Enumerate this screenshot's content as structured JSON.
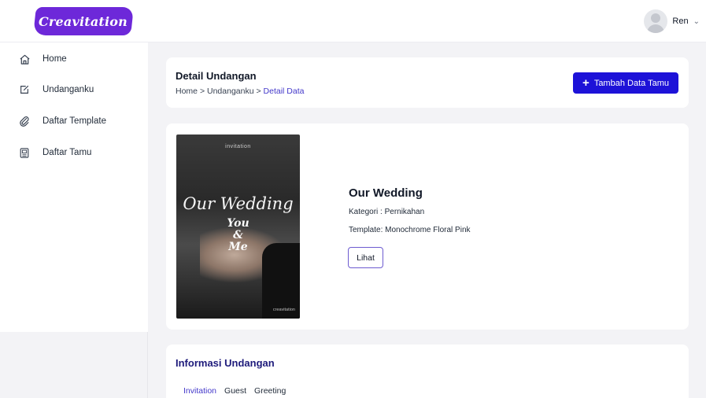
{
  "brand": {
    "logo_text": "Creavitation",
    "accent": "#6d28d9"
  },
  "user": {
    "name": "Ren",
    "avatar_icon": "user-avatar-icon",
    "menu_icon": "chevron-down-icon"
  },
  "sidebar": {
    "items": [
      {
        "label": "Home",
        "icon": "home-icon"
      },
      {
        "label": "Undanganku",
        "icon": "edit-icon"
      },
      {
        "label": "Daftar Template",
        "icon": "paperclip-icon"
      },
      {
        "label": "Daftar Tamu",
        "icon": "guest-list-icon"
      }
    ]
  },
  "header": {
    "title": "Detail Undangan",
    "breadcrumb": [
      "Home",
      "Undanganku",
      "Detail Data"
    ],
    "separator": ">",
    "add_button_label": "Tambah Data Tamu",
    "add_button_color": "#1d12d8"
  },
  "invitation": {
    "cover": {
      "top_text": "invitation",
      "title": "Our Wedding",
      "line1": "You",
      "line2": "&",
      "line3": "Me",
      "footer": "creavitation"
    },
    "title": "Our Wedding",
    "category": "Kategori : Pernikahan",
    "template": "Template: Monochrome Floral Pink",
    "view_button_label": "Lihat"
  },
  "info": {
    "title": "Informasi Undangan",
    "tabs": [
      {
        "label": "Invitation",
        "active": true
      },
      {
        "label": "Guest",
        "active": false
      },
      {
        "label": "Greeting",
        "active": false
      }
    ]
  }
}
